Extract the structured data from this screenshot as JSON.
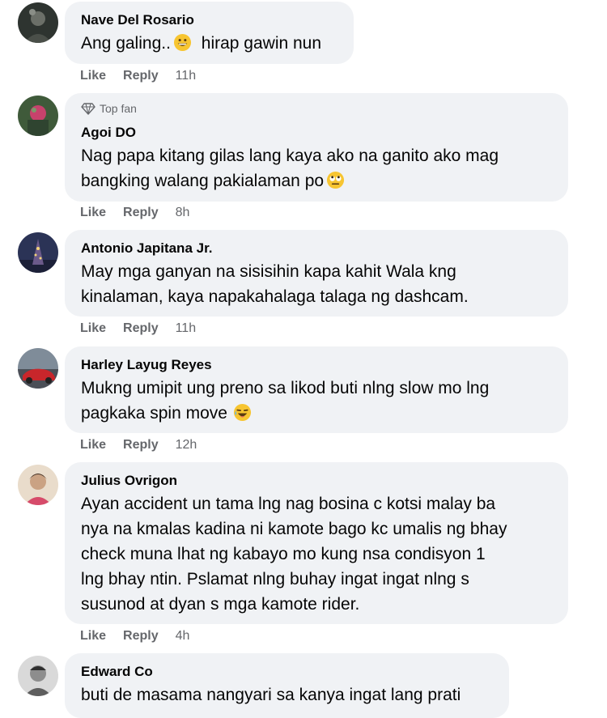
{
  "comments": [
    {
      "name": "Nave Del Rosario",
      "text_lines": [
        "Ang galing..",
        "hirap gawin nun"
      ],
      "emoji": "grin",
      "like": "Like",
      "reply": "Reply",
      "time": "11h"
    },
    {
      "badge": "Top fan",
      "name": "Agoi DO",
      "text_lines": [
        "Nag papa kitang gilas lang kaya ako na ganito ako mag",
        "bangking walang pakialaman po"
      ],
      "emoji": "rolling-eyes",
      "like": "Like",
      "reply": "Reply",
      "time": "8h"
    },
    {
      "name": "Antonio Japitana Jr.",
      "text_lines": [
        "May mga ganyan na sisisihin kapa kahit Wala kng",
        "kinalaman, kaya napakahalaga talaga ng dashcam."
      ],
      "like": "Like",
      "reply": "Reply",
      "time": "11h"
    },
    {
      "name": "Harley Layug Reyes",
      "text_lines": [
        "Mukng umipit ung preno sa likod buti nlng slow mo lng",
        "pagkaka spin move"
      ],
      "emoji": "laughing",
      "like": "Like",
      "reply": "Reply",
      "time": "12h"
    },
    {
      "name": "Julius Ovrigon",
      "text_lines": [
        "Ayan accident un tama lng nag bosina c kotsi malay ba",
        "nya na kmalas kadina ni kamote bago kc umalis ng bhay",
        "check muna lhat ng kabayo mo kung nsa condisyon 1",
        "lng bhay ntin. Pslamat nlng buhay ingat ingat nlng s",
        "susunod at dyan s mga kamote rider."
      ],
      "like": "Like",
      "reply": "Reply",
      "time": "4h"
    },
    {
      "name": "Edward Co",
      "text_lines": [
        "buti de masama nangyari sa kanya ingat lang prati"
      ]
    }
  ]
}
